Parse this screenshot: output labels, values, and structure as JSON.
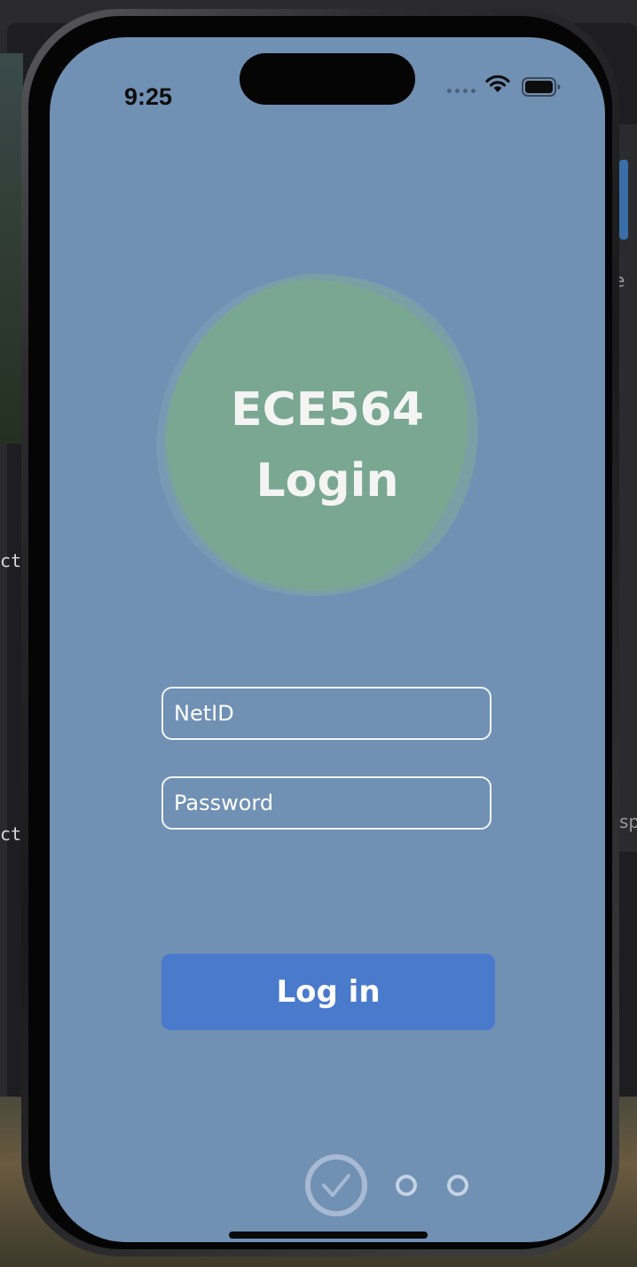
{
  "status_bar": {
    "time": "9:25"
  },
  "login": {
    "title_line1": "ECE564",
    "title_line2": "Login",
    "netid_placeholder": "NetID",
    "password_placeholder": "Password",
    "login_button": "Log in"
  },
  "background": {
    "left_text_1": "ct",
    "left_text_2": "ct",
    "right_text_1": "e",
    "right_text_2": "sp"
  },
  "page_indicator": {
    "pages": 3,
    "current": 1
  },
  "colors": {
    "screen_background": "#7090b4",
    "blob_green": "#7ea890",
    "button_blue": "#4a7acc",
    "text_light": "#f4f4f4"
  },
  "icons": [
    "wifi-icon",
    "battery-icon",
    "checkmark-circle-icon"
  ]
}
